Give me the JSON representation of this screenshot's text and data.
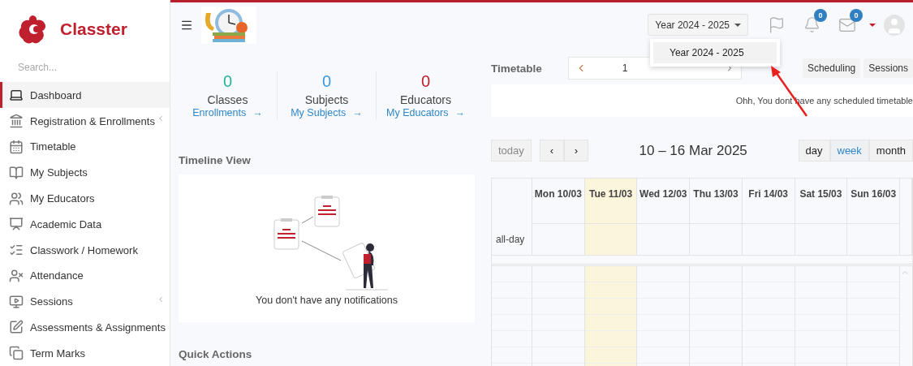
{
  "brand": {
    "name": "Classter"
  },
  "sidebar": {
    "search": {
      "placeholder": "Search..."
    },
    "items": [
      {
        "label": "Dashboard",
        "selected": true,
        "submenu": false
      },
      {
        "label": "Registration & Enrollments",
        "selected": false,
        "submenu": true
      },
      {
        "label": "Timetable",
        "selected": false,
        "submenu": false
      },
      {
        "label": "My Subjects",
        "selected": false,
        "submenu": false
      },
      {
        "label": "My Educators",
        "selected": false,
        "submenu": false
      },
      {
        "label": "Academic Data",
        "selected": false,
        "submenu": false
      },
      {
        "label": "Classwork / Homework",
        "selected": false,
        "submenu": false
      },
      {
        "label": "Attendance",
        "selected": false,
        "submenu": false
      },
      {
        "label": "Sessions",
        "selected": false,
        "submenu": true
      },
      {
        "label": "Assessments & Assignments",
        "selected": false,
        "submenu": false
      },
      {
        "label": "Term Marks",
        "selected": false,
        "submenu": false
      }
    ]
  },
  "header": {
    "year_select": "Year 2024 - 2025",
    "year_menu": [
      {
        "label": "Year 2024 - 2025",
        "selected": true
      }
    ],
    "notifications_count": "0",
    "messages_count": "0"
  },
  "stats": [
    {
      "value": "0",
      "label": "Classes",
      "link": "Enrollments",
      "arrow": "→",
      "color": "#26b59a"
    },
    {
      "value": "0",
      "label": "Subjects",
      "link": "My Subjects",
      "arrow": "→",
      "color": "#3a9be0"
    },
    {
      "value": "0",
      "label": "Educators",
      "link": "My Educators",
      "arrow": "→",
      "color": "#c0202e"
    }
  ],
  "timeline": {
    "title": "Timeline View",
    "message": "You don't have any notifications"
  },
  "quick_actions": {
    "title": "Quick Actions"
  },
  "timetable": {
    "title": "Timetable",
    "date_value": "1",
    "buttons": [
      "Scheduling",
      "Sessions"
    ],
    "message": "Ohh, You dont have any scheduled timetable"
  },
  "calendar": {
    "today_button": "today",
    "prev": "‹",
    "next": "›",
    "range": "10 – 16 Mar 2025",
    "views": [
      {
        "label": "day",
        "selected": false
      },
      {
        "label": "week",
        "selected": true
      },
      {
        "label": "month",
        "selected": false
      }
    ],
    "all_day_label": "all-day",
    "days": [
      {
        "label": "Mon 10/03",
        "today": false
      },
      {
        "label": "Tue 11/03",
        "today": true
      },
      {
        "label": "Wed 12/03",
        "today": false
      },
      {
        "label": "Thu 13/03",
        "today": false
      },
      {
        "label": "Fri 14/03",
        "today": false
      },
      {
        "label": "Sat 15/03",
        "today": false
      },
      {
        "label": "Sun 16/03",
        "today": false
      }
    ]
  }
}
